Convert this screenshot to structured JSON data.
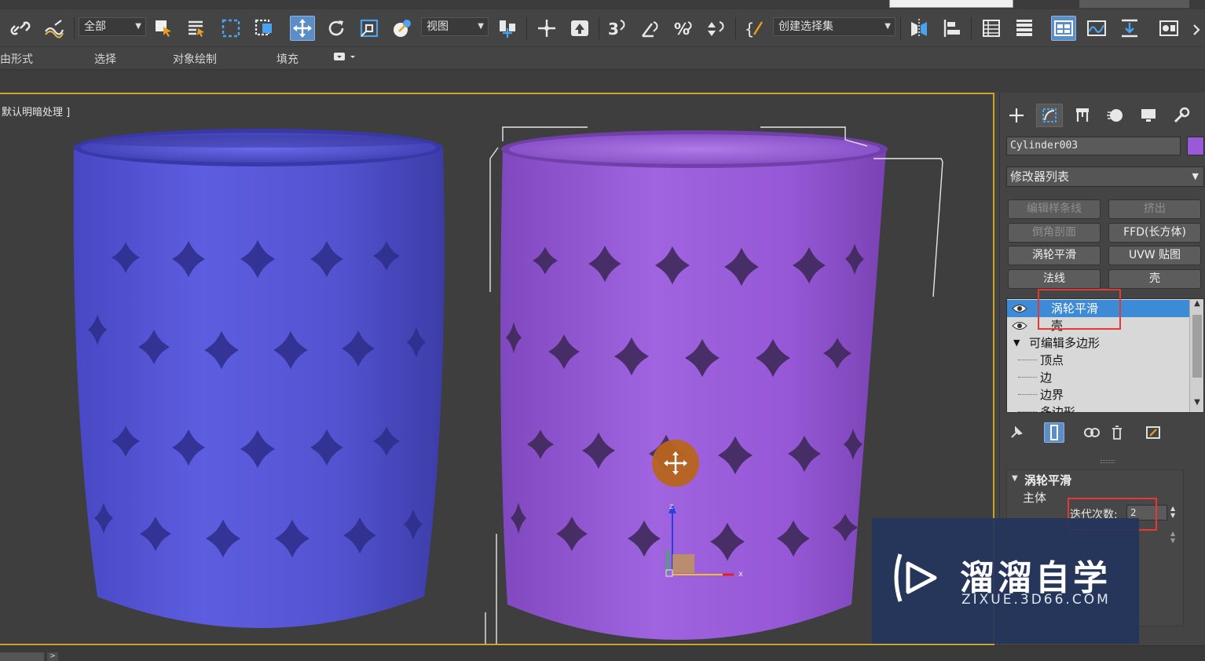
{
  "toolbar": {
    "selection_filter": "全部",
    "ref_coord": "视图",
    "named_selection_placeholder": "创建选择集"
  },
  "ribbon": {
    "tabs": [
      "自由形式",
      "选择",
      "对象绘制",
      "填充"
    ]
  },
  "viewport": {
    "label": "默认明暗处理 ]"
  },
  "command_panel": {
    "object_name": "Cylinder003",
    "object_color": "#9a5ad8",
    "modifier_list_label": "修改器列表",
    "modifier_buttons": [
      {
        "label": "编辑样条线",
        "enabled": false
      },
      {
        "label": "挤出",
        "enabled": false
      },
      {
        "label": "倒角剖面",
        "enabled": false
      },
      {
        "label": "FFD(长方体)",
        "enabled": true
      },
      {
        "label": "涡轮平滑",
        "enabled": true
      },
      {
        "label": "UVW 贴图",
        "enabled": true
      },
      {
        "label": "法线",
        "enabled": true
      },
      {
        "label": "壳",
        "enabled": true
      }
    ],
    "stack": [
      {
        "label": "涡轮平滑",
        "selected": true
      },
      {
        "label": "壳",
        "selected": false
      },
      {
        "label": "可编辑多边形",
        "selected": false
      },
      {
        "label": "顶点",
        "selected": false
      },
      {
        "label": "边",
        "selected": false
      },
      {
        "label": "边界",
        "selected": false
      },
      {
        "label": "多边形",
        "selected": false
      }
    ],
    "rollout": {
      "title": "涡轮平滑",
      "group": "主体",
      "iterations_label": "迭代次数:",
      "iterations_value": "2"
    }
  },
  "watermark": {
    "title": "溜溜自学",
    "url": "ZIXUE.3D66.COM"
  },
  "colors": {
    "accent": "#5b8ec6",
    "viewport_border": "#c9a52b",
    "left_object": "#5656d8",
    "right_object": "#9a5ad8",
    "highlight": "#e53935"
  }
}
